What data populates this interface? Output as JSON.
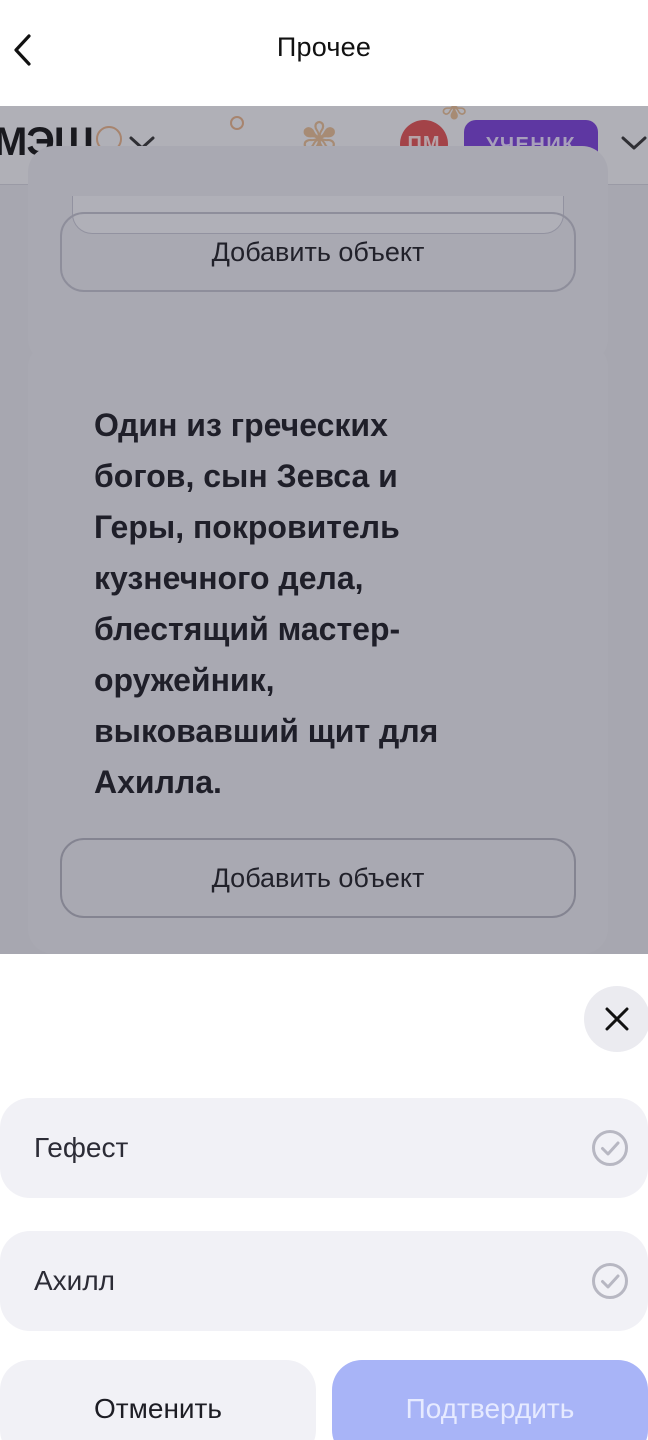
{
  "topbar": {
    "title": "Прочее",
    "back_icon": "chevron-left-icon"
  },
  "site_header": {
    "logo": "МЭШ",
    "avatar_initials": "ПМ",
    "role_badge": "УЧЕНИК",
    "colors": {
      "avatar": "#e35151",
      "role_badge": "#7a3fd9"
    }
  },
  "cards": [
    {
      "add_button_label": "Добавить объект"
    },
    {
      "question": "Один из греческих богов, сын Зевса и Геры, покровитель кузнечного дела, блестящий мастер-оружейник, выковавший щит для Ахилла.",
      "add_button_label": "Добавить объект"
    }
  ],
  "sheet": {
    "close_icon": "close-icon",
    "options": [
      {
        "label": "Гефест",
        "icon": "check-circle-icon"
      },
      {
        "label": "Ахилл",
        "icon": "check-circle-icon"
      }
    ],
    "cancel_label": "Отменить",
    "confirm_label": "Подтвердить",
    "colors": {
      "confirm_disabled": "#a8b4f7"
    }
  }
}
